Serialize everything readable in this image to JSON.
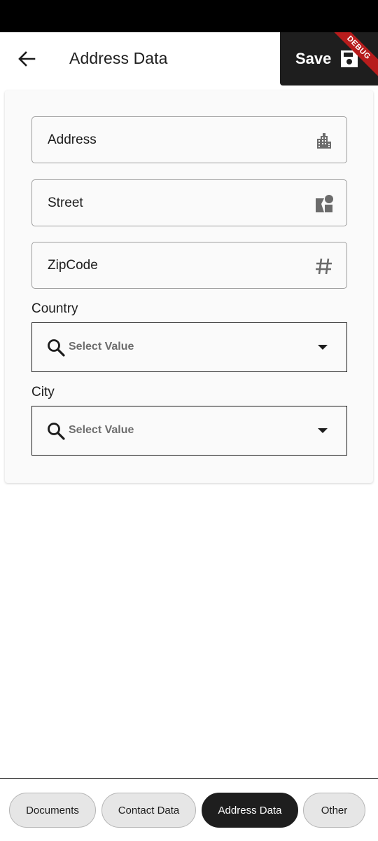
{
  "header": {
    "title": "Address Data",
    "save_label": "Save",
    "debug_banner": "DEBUG"
  },
  "form": {
    "address": {
      "label": "Address",
      "icon": "city-icon"
    },
    "street": {
      "label": "Street",
      "icon": "category-shapes-icon"
    },
    "zipcode": {
      "label": "ZipCode",
      "icon": "hashtag-icon"
    },
    "country": {
      "label": "Country",
      "placeholder": "Select Value"
    },
    "city": {
      "label": "City",
      "placeholder": "Select Value"
    }
  },
  "tabs": [
    {
      "label": "Documents",
      "active": false
    },
    {
      "label": "Contact Data",
      "active": false
    },
    {
      "label": "Address Data",
      "active": true
    },
    {
      "label": "Other",
      "active": false
    }
  ],
  "colors": {
    "accent_dark": "#1e1e1e",
    "debug_ribbon": "#b71c1c",
    "card_background": "#fafafa"
  }
}
